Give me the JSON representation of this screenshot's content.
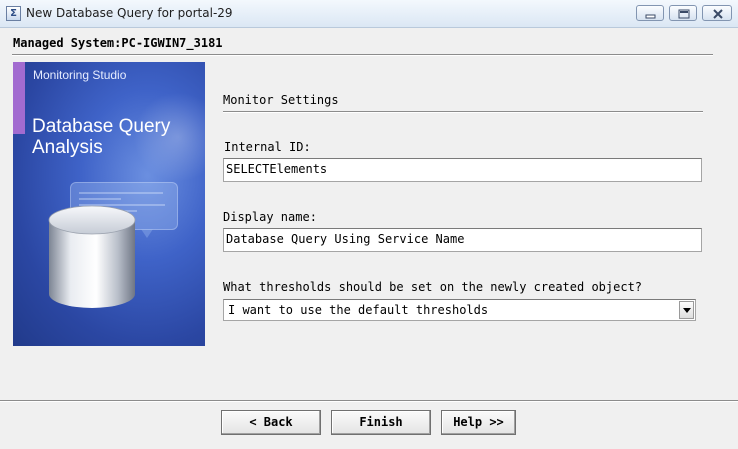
{
  "window": {
    "title": "New Database Query for portal-29",
    "app_icon": "app-icon",
    "controls": [
      "minimize-icon",
      "maximize-icon",
      "close-icon"
    ]
  },
  "header": {
    "managed_system": "Managed System:PC-IGWIN7_3181"
  },
  "banner": {
    "brand": "Monitoring Studio",
    "title": "Database Query Analysis",
    "accent_color": "#a26bd0",
    "background_color": "#2b47a3"
  },
  "form": {
    "section_title": "Monitor Settings",
    "internal_id": {
      "label": "Internal ID:",
      "value": "SELECTElements"
    },
    "display_name": {
      "label": "Display name:",
      "value": "Database Query Using Service Name"
    },
    "thresholds": {
      "label": "What thresholds should be set on the newly created object?",
      "selected": "I want to use the default thresholds"
    }
  },
  "buttons": {
    "back": "< Back",
    "finish": "Finish",
    "help": "Help >>"
  }
}
